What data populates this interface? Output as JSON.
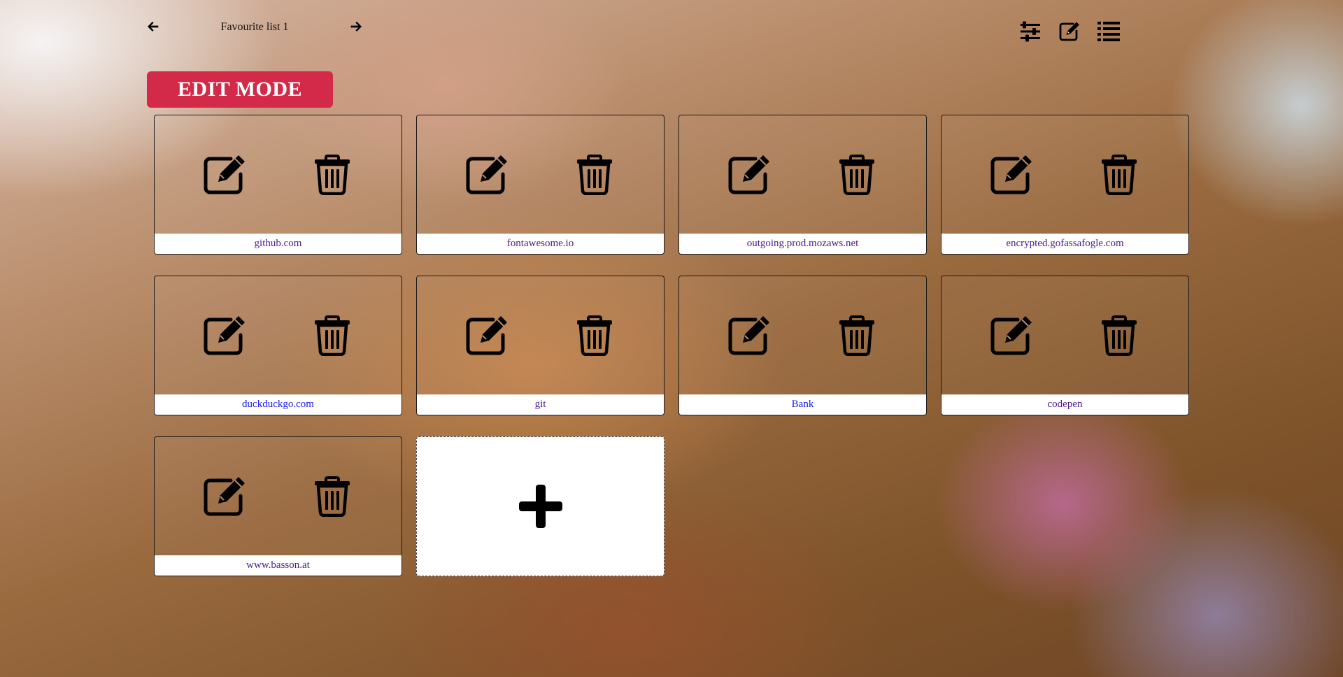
{
  "header": {
    "list_title": "Favourite list 1",
    "prev_icon": "arrow-left-icon",
    "next_icon": "arrow-right-icon",
    "toolbar_icons": [
      "sliders-icon",
      "edit-icon",
      "list-icon"
    ]
  },
  "mode_badge": {
    "label": "EDIT MODE",
    "color": "#d42a4a"
  },
  "tiles": [
    {
      "label": "github.com",
      "visited": true
    },
    {
      "label": "fontawesome.io",
      "visited": true
    },
    {
      "label": "outgoing.prod.mozaws.net",
      "visited": true
    },
    {
      "label": "encrypted.gofassafogle.com",
      "visited": true
    },
    {
      "label": "duckduckgo.com",
      "visited": false
    },
    {
      "label": "git",
      "visited": true
    },
    {
      "label": "Bank",
      "visited": false
    },
    {
      "label": "codepen",
      "visited": true
    },
    {
      "label": "www.basson.at",
      "visited": true
    }
  ],
  "tile_icons": {
    "edit": "edit-icon",
    "delete": "trash-icon"
  },
  "add_tile": {
    "icon": "plus-icon"
  },
  "colors": {
    "link_visited": "#4b1a8c",
    "link_unvisited": "#1a1aee"
  }
}
